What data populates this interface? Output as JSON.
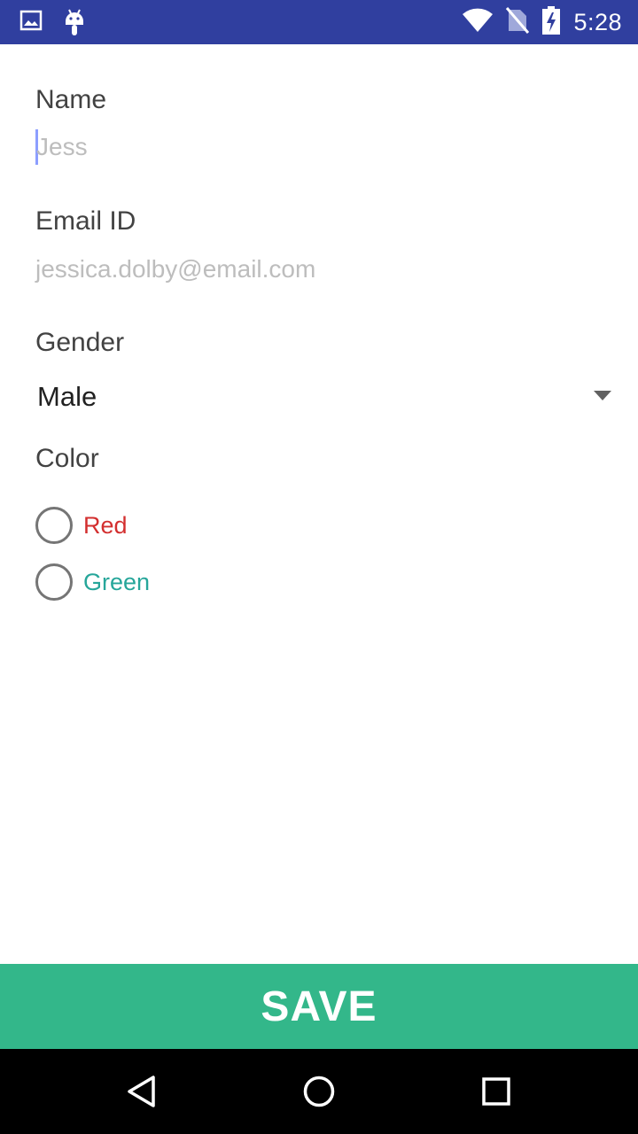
{
  "status_bar": {
    "time": "5:28",
    "left_icons": [
      "image-icon",
      "android-icon"
    ],
    "right_icons": [
      "wifi-icon",
      "no-sim-icon",
      "battery-charging-icon"
    ],
    "background_color": "#303f9f"
  },
  "form": {
    "name": {
      "label": "Name",
      "value": "Jess"
    },
    "email": {
      "label": "Email ID",
      "value": "jessica.dolby@email.com"
    },
    "gender": {
      "label": "Gender",
      "selected": "Male"
    },
    "color": {
      "label": "Color",
      "options": [
        {
          "label": "Red",
          "color": "#d32f2f",
          "selected": false
        },
        {
          "label": "Green",
          "color": "#26a69a",
          "selected": false
        }
      ]
    }
  },
  "save_button": {
    "label": "SAVE",
    "background_color": "#33b78a"
  },
  "nav_bar": {
    "buttons": [
      "back-icon",
      "home-icon",
      "recents-icon"
    ]
  }
}
